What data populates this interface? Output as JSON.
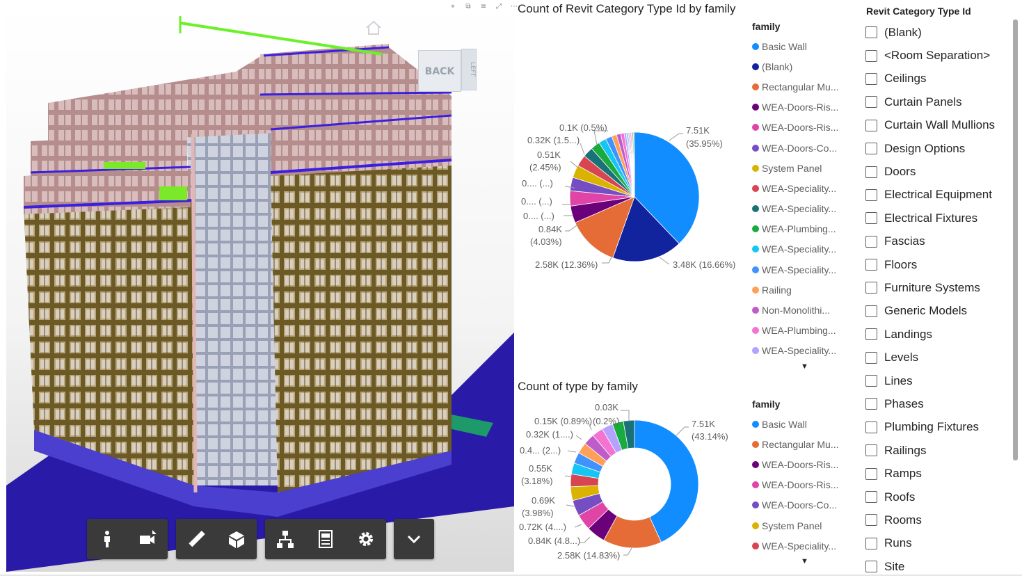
{
  "viewer": {
    "header_icons": [
      "pin-icon",
      "copy-icon",
      "filter-icon",
      "focus-icon",
      "more-icon"
    ],
    "navcube_label": "BACK",
    "navcube_side_label": "LEFT",
    "toolbar": {
      "groups": [
        [
          "person-icon",
          "camera-icon"
        ],
        [
          "measure-icon",
          "section-box-icon"
        ],
        [
          "model-tree-icon",
          "properties-icon",
          "settings-icon"
        ],
        [
          "chevron-down-icon"
        ]
      ]
    }
  },
  "pie_chart": {
    "title": "Count of Revit Category Type Id by family",
    "legend_title": "family",
    "legend": [
      {
        "label": "Basic Wall",
        "color": "#118DFF"
      },
      {
        "label": "(Blank)",
        "color": "#12239E"
      },
      {
        "label": "Rectangular Mu...",
        "color": "#E66C37"
      },
      {
        "label": "WEA-Doors-Ris...",
        "color": "#6B007B"
      },
      {
        "label": "WEA-Doors-Ris...",
        "color": "#E044A7"
      },
      {
        "label": "WEA-Doors-Co...",
        "color": "#744EC2"
      },
      {
        "label": "System Panel",
        "color": "#D9B300"
      },
      {
        "label": "WEA-Speciality...",
        "color": "#D64550"
      },
      {
        "label": "WEA-Speciality...",
        "color": "#197278"
      },
      {
        "label": "WEA-Plumbing...",
        "color": "#1AAB40"
      },
      {
        "label": "WEA-Speciality...",
        "color": "#15C6F4"
      },
      {
        "label": "WEA-Speciality...",
        "color": "#4092FF"
      },
      {
        "label": "Railing",
        "color": "#FFA058"
      },
      {
        "label": "Non-Monolithi...",
        "color": "#BE5DC9"
      },
      {
        "label": "WEA-Plumbing...",
        "color": "#F472D0"
      },
      {
        "label": "WEA-Speciality...",
        "color": "#B5A1FF"
      }
    ],
    "data_labels": [
      "7.51K",
      "(35.95%)",
      "3.48K (16.66%)",
      "2.58K (12.36%)",
      "0.84K",
      "(4.03%)",
      "0.... (...)",
      "0.... (...)",
      "0.... (...)",
      "0.51K",
      "(2.45%)",
      "0.32K (1.5...)",
      "0.1K (0.5%)"
    ]
  },
  "donut_chart": {
    "title": "Count of type by family",
    "legend_title": "family",
    "legend": [
      {
        "label": "Basic Wall",
        "color": "#118DFF"
      },
      {
        "label": "Rectangular Mu...",
        "color": "#E66C37"
      },
      {
        "label": "WEA-Doors-Ris...",
        "color": "#6B007B"
      },
      {
        "label": "WEA-Doors-Ris...",
        "color": "#E044A7"
      },
      {
        "label": "WEA-Doors-Co...",
        "color": "#744EC2"
      },
      {
        "label": "System Panel",
        "color": "#D9B300"
      },
      {
        "label": "WEA-Speciality...",
        "color": "#D64550"
      }
    ],
    "data_labels": [
      "7.51K",
      "(43.14%)",
      "2.58K (14.83%)",
      "0.84K (4.8...)",
      "0.72K (4....)",
      "0.69K",
      "(3.98%)",
      "0.55K",
      "(3.18%)",
      "0.4... (2...)",
      "0.32K (1....)",
      "0.15K (0.89%)",
      "(0.2%)",
      "0.03K"
    ]
  },
  "chart_data": [
    {
      "type": "pie",
      "title": "Count of Revit Category Type Id by family",
      "legend_title": "family",
      "categories": [
        "Basic Wall",
        "(Blank)",
        "Rectangular Mu...",
        "WEA-Doors-Ris...",
        "WEA-Doors-Ris...",
        "WEA-Doors-Co...",
        "System Panel",
        "WEA-Speciality...",
        "WEA-Speciality...",
        "WEA-Plumbing...",
        "WEA-Speciality...",
        "WEA-Speciality...",
        "Railing",
        "Non-Monolithi...",
        "WEA-Plumbing...",
        "WEA-Speciality..."
      ],
      "values": [
        35.95,
        16.66,
        12.36,
        4.03,
        3.6,
        3.2,
        3.0,
        2.7,
        2.45,
        2.2,
        1.8,
        1.5,
        1.2,
        1.0,
        0.8,
        0.5
      ],
      "colors": [
        "#118DFF",
        "#12239E",
        "#E66C37",
        "#6B007B",
        "#E044A7",
        "#744EC2",
        "#D9B300",
        "#D64550",
        "#197278",
        "#1AAB40",
        "#15C6F4",
        "#4092FF",
        "#FFA058",
        "#BE5DC9",
        "#F472D0",
        "#B5A1FF"
      ],
      "rest_value": 1.95,
      "legend_position": "right"
    },
    {
      "type": "pie",
      "style": "donut",
      "title": "Count of type by family",
      "legend_title": "family",
      "categories": [
        "Basic Wall",
        "Rectangular Mu...",
        "WEA-Doors-Ris...",
        "WEA-Doors-Ris...",
        "WEA-Doors-Co...",
        "System Panel",
        "WEA-Speciality..."
      ],
      "values": [
        43.14,
        14.83,
        4.8,
        4.1,
        3.98,
        3.5,
        3.18
      ],
      "colors": [
        "#118DFF",
        "#E66C37",
        "#6B007B",
        "#E044A7",
        "#744EC2",
        "#D9B300",
        "#D64550"
      ],
      "rest_value": 22.47,
      "legend_position": "right"
    }
  ],
  "slicer": {
    "title": "Revit Category Type Id",
    "items": [
      "(Blank)",
      "<Room Separation>",
      "Ceilings",
      "Curtain Panels",
      "Curtain Wall Mullions",
      "Design Options",
      "Doors",
      "Electrical Equipment",
      "Electrical Fixtures",
      "Fascias",
      "Floors",
      "Furniture Systems",
      "Generic Models",
      "Landings",
      "Levels",
      "Lines",
      "Phases",
      "Plumbing Fixtures",
      "Railings",
      "Ramps",
      "Roofs",
      "Rooms",
      "Runs",
      "Site"
    ]
  }
}
